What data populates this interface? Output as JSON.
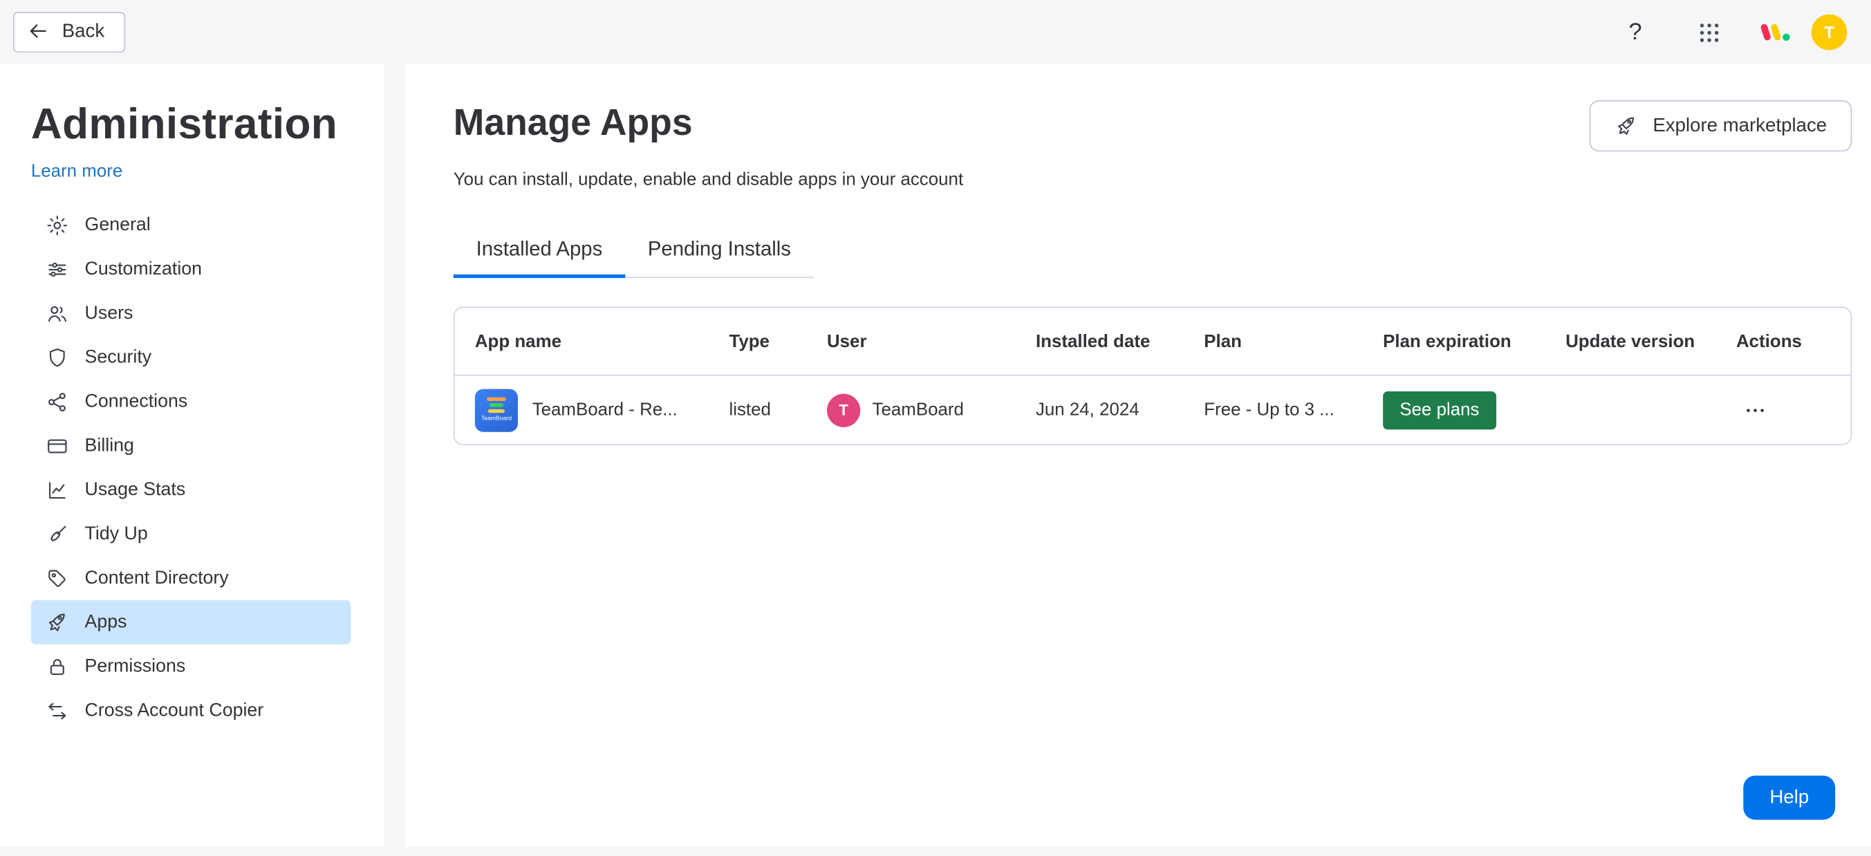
{
  "topbar": {
    "back_label": "Back",
    "help_glyph": "?",
    "avatar_initial": "T"
  },
  "sidebar": {
    "title": "Administration",
    "learn_more_label": "Learn more",
    "items": [
      {
        "label": "General",
        "icon": "gear-icon"
      },
      {
        "label": "Customization",
        "icon": "sliders-icon"
      },
      {
        "label": "Users",
        "icon": "users-icon"
      },
      {
        "label": "Security",
        "icon": "shield-icon"
      },
      {
        "label": "Connections",
        "icon": "nodes-icon"
      },
      {
        "label": "Billing",
        "icon": "credit-card-icon"
      },
      {
        "label": "Usage Stats",
        "icon": "line-chart-icon"
      },
      {
        "label": "Tidy Up",
        "icon": "broom-icon"
      },
      {
        "label": "Content Directory",
        "icon": "tag-icon"
      },
      {
        "label": "Apps",
        "icon": "rocket-icon",
        "selected": true
      },
      {
        "label": "Permissions",
        "icon": "lock-icon"
      },
      {
        "label": "Cross Account Copier",
        "icon": "transfer-arrows-icon"
      }
    ]
  },
  "main": {
    "title": "Manage Apps",
    "subtitle": "You can install, update, enable and disable apps in your account",
    "explore_button_label": "Explore marketplace",
    "tabs": [
      {
        "label": "Installed Apps",
        "active": true
      },
      {
        "label": "Pending Installs",
        "active": false
      }
    ],
    "table": {
      "headers": [
        "App name",
        "Type",
        "User",
        "Installed date",
        "Plan",
        "Plan expiration",
        "Update version",
        "Actions"
      ],
      "rows": [
        {
          "app_name": "TeamBoard - Re...",
          "app_icon_label": "TeamBoard",
          "type": "listed",
          "user_avatar_initial": "T",
          "user_name": "TeamBoard",
          "installed_date": "Jun 24, 2024",
          "plan": "Free - Up to 3 ...",
          "plan_expiration_action": "See plans",
          "update_version": "",
          "actions_icon": "more-horizontal-icon"
        }
      ]
    }
  },
  "help_button_label": "Help",
  "colors": {
    "accent_blue": "#0073ea",
    "link_blue": "#1f76c2",
    "selected_item_bg": "#cce5ff",
    "see_plans_green": "#1f7d4c",
    "topbar_avatar_yellow": "#ffcb00",
    "row_avatar_pink": "#e2447d",
    "app_icon_blue": "#2d75e8",
    "page_bg": "#f5f6f8",
    "text": "#323338",
    "border": "#d0d4e4"
  }
}
